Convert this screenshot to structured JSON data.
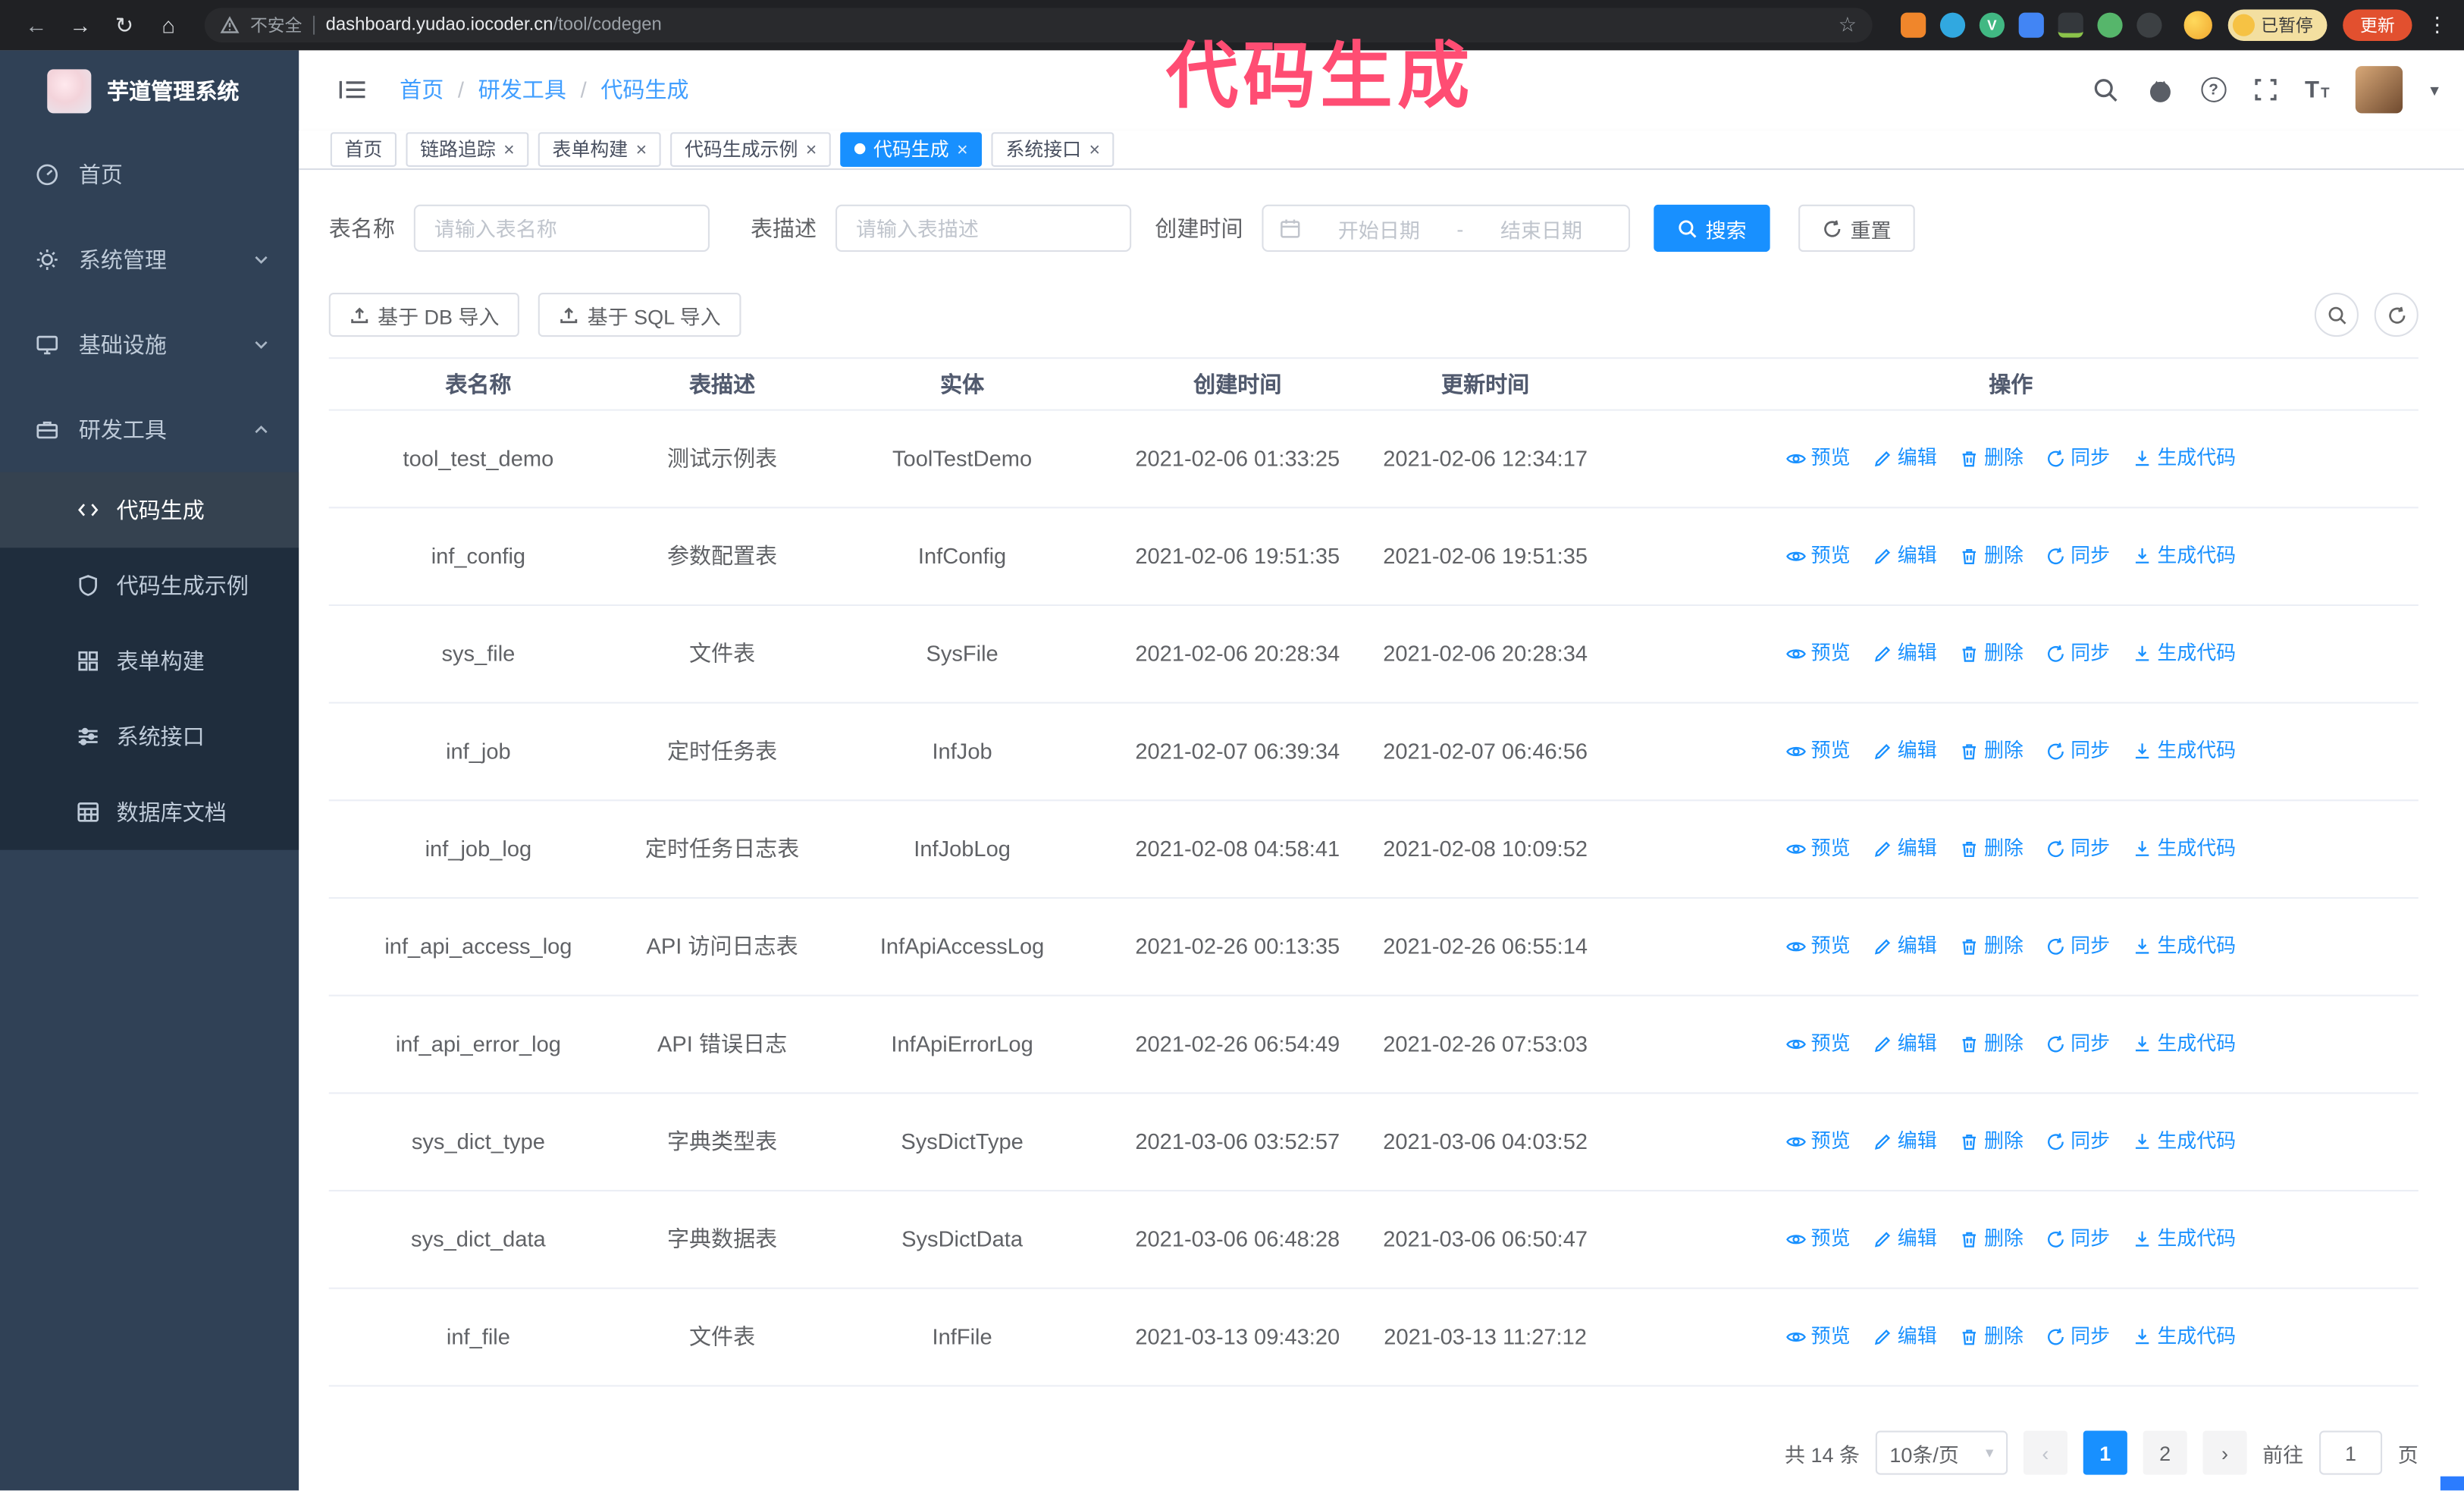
{
  "colors": {
    "accent": "#1890ff",
    "link": "#409eff",
    "annotation": "#ff4d73",
    "sidebar_bg": "#304156",
    "submenu_bg": "#1f2d3d",
    "sidebar_text": "#bfcbd9",
    "chrome_bg": "#202124",
    "omnibox_bg": "#292a2d",
    "update_btn": "#e2502f",
    "paused_bg": "#f3dfa0",
    "header_text": "#515a6e",
    "body_text": "#606266",
    "border": "#dcdfe6",
    "row_border": "#ebeef5",
    "placeholder": "#bfc4cc",
    "chip_bg": "#f4f4f5"
  },
  "icons": {
    "back": "←",
    "forward": "→",
    "reload": "↻",
    "home": "⌂",
    "star": "☆",
    "kebab": "⋮",
    "close": "×",
    "caret_down": "▾",
    "question": "?",
    "prev": "‹",
    "next": "›",
    "font_big": "T",
    "font_small": "T",
    "vue_badge": "V"
  },
  "browser": {
    "security_label": "不安全",
    "url_host": "dashboard.yudao.iocoder.cn",
    "url_path": "/tool/codegen",
    "paused_badge": "已暂停",
    "update_button": "更新"
  },
  "annotation": "代码生成",
  "sidebar": {
    "logo_title": "芋道管理系统",
    "items": [
      {
        "label": "首页"
      },
      {
        "label": "系统管理"
      },
      {
        "label": "基础设施"
      },
      {
        "label": "研发工具"
      }
    ],
    "sub_items": [
      {
        "label": "代码生成"
      },
      {
        "label": "代码生成示例"
      },
      {
        "label": "表单构建"
      },
      {
        "label": "系统接口"
      },
      {
        "label": "数据库文档"
      }
    ]
  },
  "header": {
    "breadcrumb": [
      "首页",
      "研发工具",
      "代码生成"
    ],
    "separator": "/"
  },
  "tabs": [
    {
      "label": "首页",
      "closable": false,
      "active": false
    },
    {
      "label": "链路追踪",
      "closable": true,
      "active": false
    },
    {
      "label": "表单构建",
      "closable": true,
      "active": false
    },
    {
      "label": "代码生成示例",
      "closable": true,
      "active": false
    },
    {
      "label": "代码生成",
      "closable": true,
      "active": true
    },
    {
      "label": "系统接口",
      "closable": true,
      "active": false
    }
  ],
  "filters": {
    "table_name_label": "表名称",
    "table_name_placeholder": "请输入表名称",
    "table_desc_label": "表描述",
    "table_desc_placeholder": "请输入表描述",
    "create_time_label": "创建时间",
    "date_start_placeholder": "开始日期",
    "date_separator": "-",
    "date_end_placeholder": "结束日期",
    "search_button": "搜索",
    "reset_button": "重置"
  },
  "toolbar": {
    "import_db": "基于 DB 导入",
    "import_sql": "基于 SQL 导入"
  },
  "table": {
    "columns": [
      "表名称",
      "表描述",
      "实体",
      "创建时间",
      "更新时间",
      "操作"
    ],
    "actions": [
      "预览",
      "编辑",
      "删除",
      "同步",
      "生成代码"
    ],
    "rows": [
      {
        "name": "tool_test_demo",
        "desc": "测试示例表",
        "entity": "ToolTestDemo",
        "created": "2021-02-06 01:33:25",
        "updated": "2021-02-06 12:34:17"
      },
      {
        "name": "inf_config",
        "desc": "参数配置表",
        "entity": "InfConfig",
        "created": "2021-02-06 19:51:35",
        "updated": "2021-02-06 19:51:35"
      },
      {
        "name": "sys_file",
        "desc": "文件表",
        "entity": "SysFile",
        "created": "2021-02-06 20:28:34",
        "updated": "2021-02-06 20:28:34"
      },
      {
        "name": "inf_job",
        "desc": "定时任务表",
        "entity": "InfJob",
        "created": "2021-02-07 06:39:34",
        "updated": "2021-02-07 06:46:56"
      },
      {
        "name": "inf_job_log",
        "desc": "定时任务日志表",
        "entity": "InfJobLog",
        "created": "2021-02-08 04:58:41",
        "updated": "2021-02-08 10:09:52"
      },
      {
        "name": "inf_api_access_log",
        "desc": "API 访问日志表",
        "entity": "InfApiAccessLog",
        "created": "2021-02-26 00:13:35",
        "updated": "2021-02-26 06:55:14"
      },
      {
        "name": "inf_api_error_log",
        "desc": "API 错误日志",
        "entity": "InfApiErrorLog",
        "created": "2021-02-26 06:54:49",
        "updated": "2021-02-26 07:53:03"
      },
      {
        "name": "sys_dict_type",
        "desc": "字典类型表",
        "entity": "SysDictType",
        "created": "2021-03-06 03:52:57",
        "updated": "2021-03-06 04:03:52"
      },
      {
        "name": "sys_dict_data",
        "desc": "字典数据表",
        "entity": "SysDictData",
        "created": "2021-03-06 06:48:28",
        "updated": "2021-03-06 06:50:47"
      },
      {
        "name": "inf_file",
        "desc": "文件表",
        "entity": "InfFile",
        "created": "2021-03-13 09:43:20",
        "updated": "2021-03-13 11:27:12"
      }
    ]
  },
  "pagination": {
    "total": "共 14 条",
    "page_size": "10条/页",
    "pages": [
      "1",
      "2"
    ],
    "active_page": "1",
    "goto_label": "前往",
    "goto_value": "1",
    "goto_suffix": "页"
  }
}
